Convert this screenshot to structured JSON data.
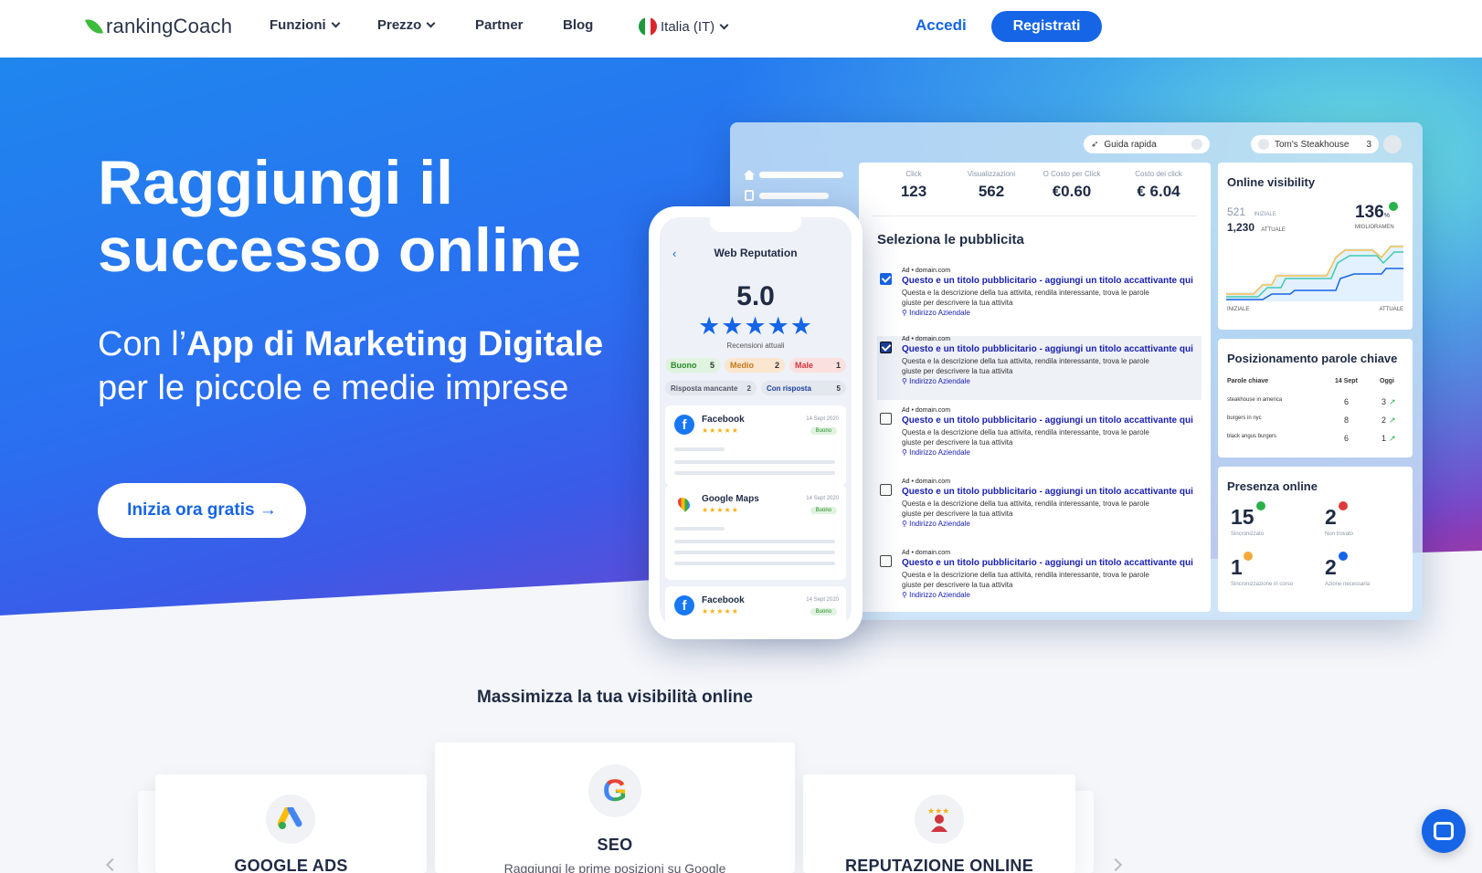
{
  "nav": {
    "logo": "rankingCoach",
    "items": [
      "Funzioni",
      "Prezzo",
      "Partner",
      "Blog"
    ],
    "language": "Italia (IT)",
    "login": "Accedi",
    "register": "Registrati"
  },
  "hero": {
    "title": "Raggiungi il successo online",
    "sub_pre": "Con l’",
    "sub_bold": "App di Marketing Digitale",
    "sub_post": " per le piccole e medie imprese",
    "cta": "Inizia ora gratis →"
  },
  "dashboard": {
    "quick_guide": "Guida rapida",
    "account": "Tom's Steakhouse",
    "account_count": "3",
    "stats": [
      {
        "label": "Click",
        "value": "123"
      },
      {
        "label": "Visualizzazioni",
        "value": "562"
      },
      {
        "label": "O Costo per Click",
        "value": "€0.60"
      },
      {
        "label": "Costo dei click",
        "value": "€ 6.04"
      }
    ],
    "select_title": "Seleziona le pubblicita",
    "ads": [
      {
        "domain": "Ad • domain.com",
        "title": "Questo e un titolo pubblicitario - aggiungi un titolo accattivante qui",
        "desc": "Questa e la descrizione della tua attivita, rendila interessante, trova le parole giuste per descrivere la tua attivita",
        "address": "Indirizzo Aziendale",
        "checked": true
      },
      {
        "domain": "Ad • domain.com",
        "title": "Questo e un titolo pubblicitario - aggiungi un titolo accattivante qui",
        "desc": "Questa e la descrizione della tua attivita, rendila interessante, trova le parole giuste per descrivere la tua attivita",
        "address": "Indirizzo Aziendale",
        "checked": true
      },
      {
        "domain": "Ad • domain.com",
        "title": "Questo e un titolo pubblicitario - aggiungi un titolo accattivante qui",
        "desc": "Questa e la descrizione della tua attivita, rendila interessante, trova le parole giuste per descrivere la tua attivita",
        "address": "Indirizzo Aziendale",
        "checked": false
      },
      {
        "domain": "Ad • domain.com",
        "title": "Questo e un titolo pubblicitario - aggiungi un titolo accattivante qui",
        "desc": "Questa e la descrizione della tua attivita, rendila interessante, trova le parole giuste per descrivere la tua attivita",
        "address": "Indirizzo Aziendale",
        "checked": false
      },
      {
        "domain": "Ad • domain.com",
        "title": "Questo e un titolo pubblicitario - aggiungi un titolo accattivante qui",
        "desc": "Questa e la descrizione della tua attivita, rendila interessante, trova le parole giuste per descrivere la tua attivita",
        "address": "Indirizzo Aziendale",
        "checked": false
      }
    ],
    "visibility": {
      "title": "Online visibility",
      "initial_value": "521",
      "initial_label": "INIZIALE",
      "current_value": "1,230",
      "current_label": "ATTUALE",
      "improvement": "136",
      "improvement_unit": "%",
      "improvement_label": "MIGLIORAMEN",
      "axis_start": "INIZIALE",
      "axis_end": "ATTUALE"
    },
    "keywords": {
      "title": "Posizionamento parole chiave",
      "headers": [
        "Parole chiave",
        "14 Sept",
        "Oggi"
      ],
      "rows": [
        {
          "kw": "steakhouse in america",
          "before": "6",
          "now": "3"
        },
        {
          "kw": "burgers in nyc",
          "before": "8",
          "now": "2"
        },
        {
          "kw": "black angus burgers",
          "before": "6",
          "now": "1"
        }
      ]
    },
    "presence": {
      "title": "Presenza online",
      "items": [
        {
          "value": "15",
          "label": "Sincronizzato"
        },
        {
          "value": "2",
          "label": "Non trovato"
        },
        {
          "value": "1",
          "label": "Sincronizzazione in corso"
        },
        {
          "value": "2",
          "label": "Azione necessaria"
        }
      ]
    }
  },
  "phone": {
    "title": "Web Reputation",
    "score": "5.0",
    "stars": "★★★★★",
    "caption": "Recensioni attuali",
    "chips": [
      {
        "label": "Buono",
        "count": "5"
      },
      {
        "label": "Medio",
        "count": "2"
      },
      {
        "label": "Male",
        "count": "1"
      },
      {
        "label": "Risposta mancante",
        "count": "2"
      },
      {
        "label": "Con risposta",
        "count": "5"
      }
    ],
    "reviews": [
      {
        "source": "Facebook",
        "date": "14 Sept 2020",
        "badge": "Buono",
        "stars": "★★★★★"
      },
      {
        "source": "Google Maps",
        "date": "14 Sept 2020",
        "badge": "Buono",
        "stars": "★★★★★"
      },
      {
        "source": "Facebook",
        "date": "14 Sept 2020",
        "badge": "Buono",
        "stars": "★★★★★"
      }
    ]
  },
  "section": {
    "title": "Massimizza la tua visibilità online",
    "cards": [
      {
        "title": "GOOGLE ADS",
        "desc": ""
      },
      {
        "title": "SEO",
        "desc": "Raggiungi le prime posizioni su Google"
      },
      {
        "title": "REPUTAZIONE ONLINE",
        "desc": ""
      }
    ]
  },
  "colors": {
    "accent": "#1565e6",
    "ad_title": "#1a20b0",
    "good": "#2ab24a",
    "bad": "#e03a3a"
  }
}
